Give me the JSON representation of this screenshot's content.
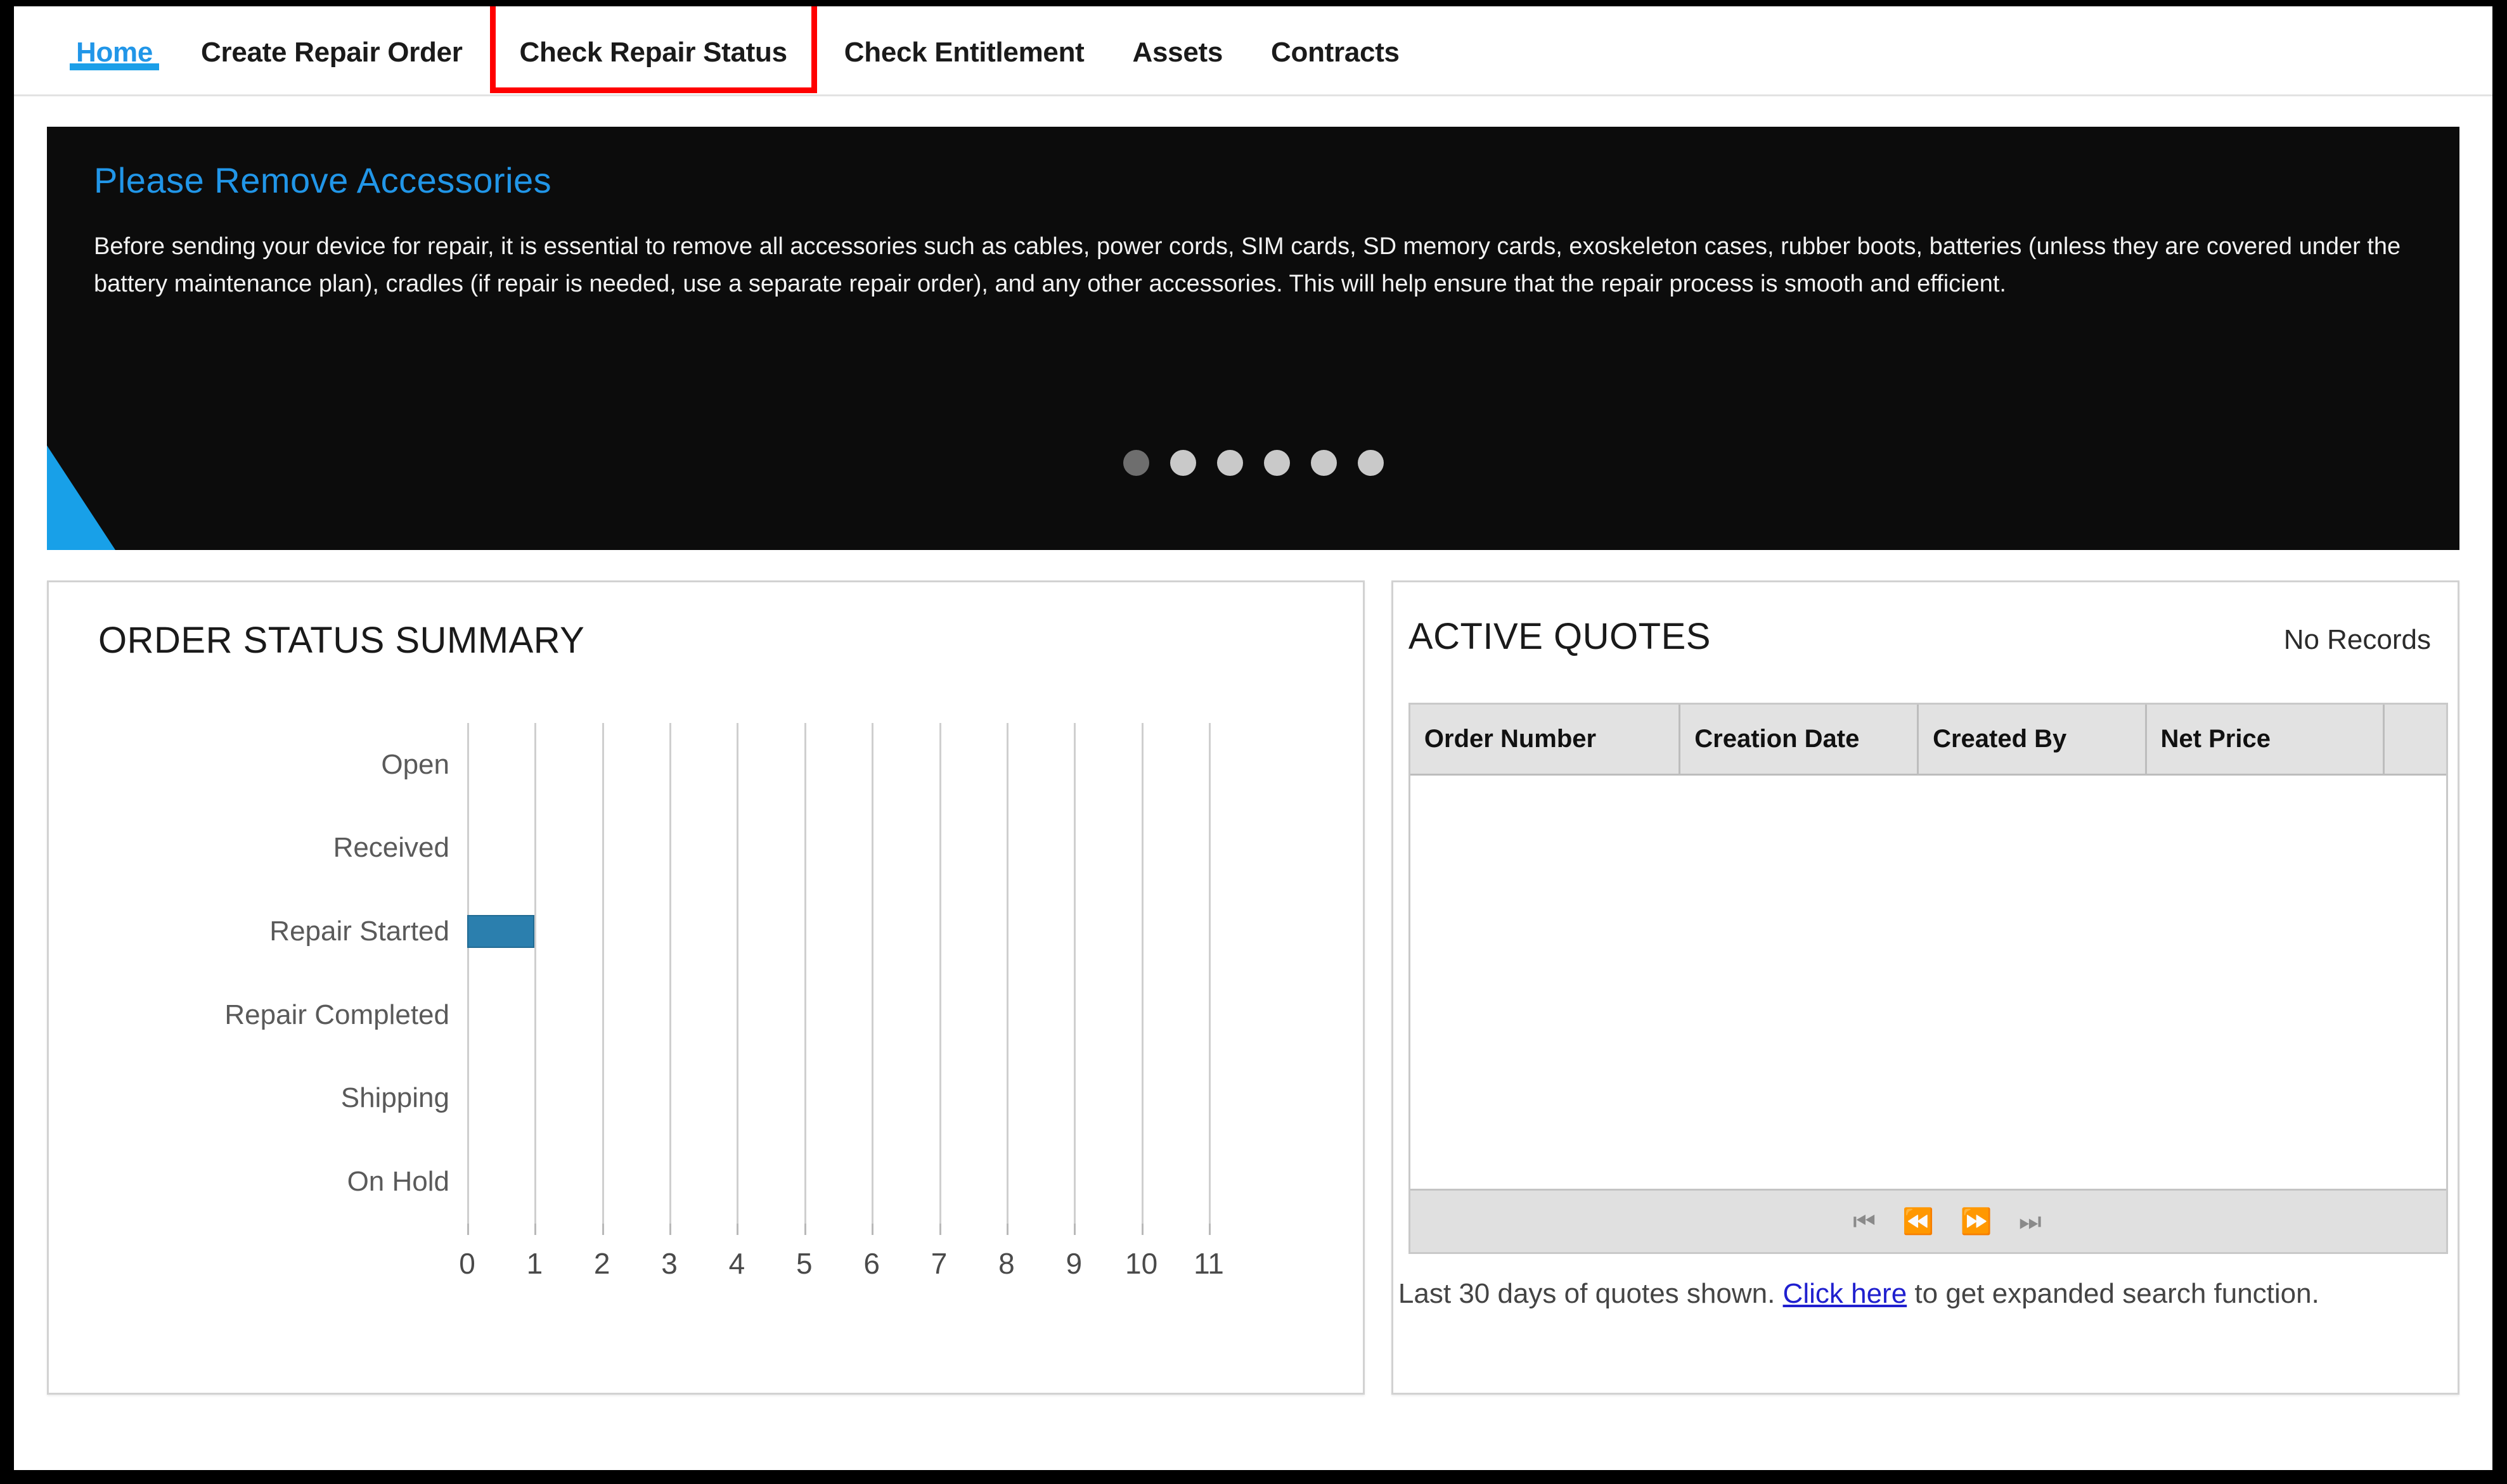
{
  "nav": {
    "items": [
      {
        "label": "Home",
        "active": true,
        "highlighted": false
      },
      {
        "label": "Create Repair Order",
        "active": false,
        "highlighted": false
      },
      {
        "label": "Check Repair Status",
        "active": false,
        "highlighted": true
      },
      {
        "label": "Check Entitlement",
        "active": false,
        "highlighted": false
      },
      {
        "label": "Assets",
        "active": false,
        "highlighted": false
      },
      {
        "label": "Contracts",
        "active": false,
        "highlighted": false
      }
    ],
    "highlight_color": "#ff0000",
    "active_color": "#2196e8"
  },
  "hero": {
    "title": "Please Remove Accessories",
    "body": "Before sending your device for repair, it is essential to remove all accessories such as cables, power cords, SIM cards, SD memory cards, exoskeleton cases, rubber boots, batteries (unless they are covered under the battery maintenance plan), cradles (if repair is needed, use a separate repair order), and any other accessories. This will help ensure that the repair process is smooth and efficient.",
    "background_color": "#0c0c0c",
    "accent_color": "#18a0e8",
    "dots": [
      {
        "state": "dim"
      },
      {
        "state": "normal"
      },
      {
        "state": "normal"
      },
      {
        "state": "normal"
      },
      {
        "state": "normal"
      },
      {
        "state": "normal"
      }
    ]
  },
  "order_status": {
    "title": "ORDER STATUS SUMMARY"
  },
  "chart_data": {
    "type": "bar",
    "orientation": "horizontal",
    "title": "ORDER STATUS SUMMARY",
    "categories": [
      "Open",
      "Received",
      "Repair Started",
      "Repair Completed",
      "Shipping",
      "On Hold"
    ],
    "values": [
      0,
      0,
      1,
      0,
      0,
      0
    ],
    "xlabel": "",
    "ylabel": "",
    "xlim": [
      0,
      11
    ],
    "xticks": [
      0,
      1,
      2,
      3,
      4,
      5,
      6,
      7,
      8,
      9,
      10,
      11
    ],
    "tick_labels": [
      "0",
      "1",
      "2",
      "3",
      "4",
      "5",
      "6",
      "7",
      "8",
      "9",
      "10",
      "11"
    ],
    "grid": true,
    "legend": false,
    "bar_color": "#2b7fae"
  },
  "quotes": {
    "title": "ACTIVE QUOTES",
    "status": "No Records",
    "columns": [
      "Order Number",
      "Creation Date",
      "Created By",
      "Net Price",
      ""
    ],
    "rows": [],
    "pager": [
      {
        "icon": "first-page-icon",
        "glyph": "⏮"
      },
      {
        "icon": "previous-page-icon",
        "glyph": "⏪"
      },
      {
        "icon": "next-page-icon",
        "glyph": "⏩"
      },
      {
        "icon": "last-page-icon",
        "glyph": "⏭"
      }
    ],
    "footnote_prefix": "Last 30 days of quotes shown. ",
    "footnote_link": "Click here",
    "footnote_suffix": " to get expanded search function."
  }
}
